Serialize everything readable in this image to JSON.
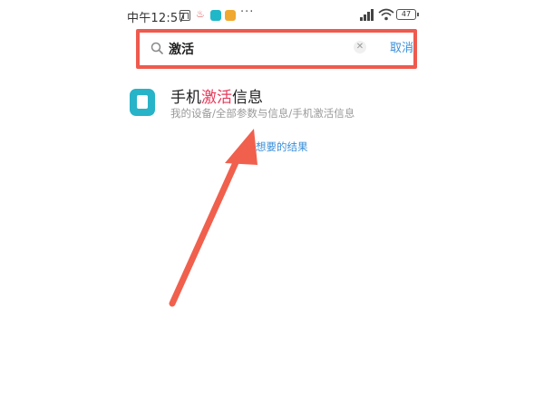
{
  "status_bar": {
    "time": "中午12:57",
    "dots": "···",
    "battery": "47"
  },
  "search": {
    "query": "激活",
    "cancel_label": "取消"
  },
  "result": {
    "title_prefix": "手机",
    "title_highlight": "激活",
    "title_suffix": "信息",
    "path": "我的设备/全部参数与信息/手机激活信息"
  },
  "hint_link": "想要的结果",
  "colors": {
    "highlight": "#e6395a",
    "annotation": "#ef5a4e",
    "link": "#3a8fd9",
    "app_icon": "#27b3c8"
  }
}
